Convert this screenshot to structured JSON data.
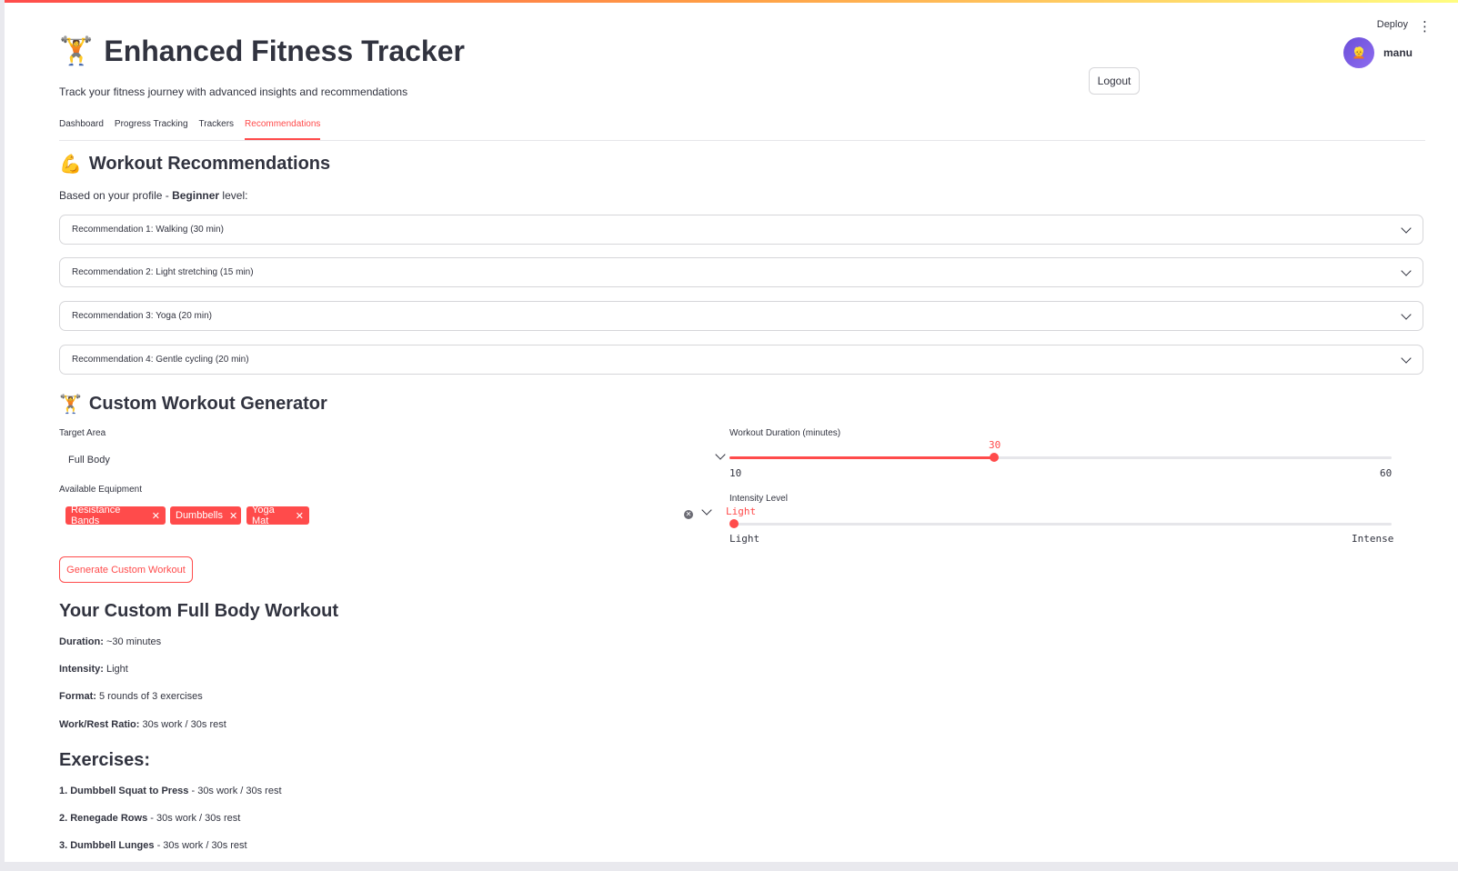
{
  "header": {
    "deploy_label": "Deploy",
    "menu_icon": "kebab-menu-icon",
    "title_icon": "weightlifter-emoji",
    "title": "Enhanced Fitness Tracker",
    "subtitle": "Track your fitness journey with advanced insights and recommendations",
    "username": "manu",
    "logout_label": "Logout"
  },
  "tabs": [
    {
      "label": "Dashboard",
      "active": false
    },
    {
      "label": "Progress Tracking",
      "active": false
    },
    {
      "label": "Trackers",
      "active": false
    },
    {
      "label": "Recommendations",
      "active": true
    }
  ],
  "recommendations": {
    "icon": "flexed-biceps-emoji",
    "heading": "Workout Recommendations",
    "profile_prefix": "Based on your profile - ",
    "profile_level": "Beginner",
    "profile_suffix": " level:",
    "items": [
      "Recommendation 1: Walking (30 min)",
      "Recommendation 2: Light stretching (15 min)",
      "Recommendation 3: Yoga (20 min)",
      "Recommendation 4: Gentle cycling (20 min)"
    ]
  },
  "generator": {
    "icon": "weightlifter-emoji",
    "heading": "Custom Workout Generator",
    "target_area": {
      "label": "Target Area",
      "value": "Full Body"
    },
    "equipment": {
      "label": "Available Equipment",
      "selected": [
        "Resistance Bands",
        "Dumbbells",
        "Yoga Mat"
      ]
    },
    "duration": {
      "label": "Workout Duration (minutes)",
      "value": "30",
      "min": "10",
      "max": "60",
      "fraction": 0.4
    },
    "intensity": {
      "label": "Intensity Level",
      "value": "Light",
      "min": "Light",
      "max": "Intense",
      "fraction": 0
    },
    "generate_label": "Generate Custom Workout"
  },
  "workout": {
    "heading": "Your Custom Full Body Workout",
    "details": [
      {
        "label": "Duration:",
        "value": " ~30 minutes"
      },
      {
        "label": "Intensity:",
        "value": " Light"
      },
      {
        "label": "Format:",
        "value": " 5 rounds of 3 exercises"
      },
      {
        "label": "Work/Rest Ratio:",
        "value": " 30s work / 30s rest"
      }
    ],
    "exercises_heading": "Exercises:",
    "exercises": [
      {
        "label": "1. Dumbbell Squat to Press",
        "value": " - 30s work / 30s rest"
      },
      {
        "label": "2. Renegade Rows",
        "value": " - 30s work / 30s rest"
      },
      {
        "label": "3. Dumbbell Lunges",
        "value": " - 30s work / 30s rest"
      }
    ]
  },
  "colors": {
    "accent": "#ff4b4b",
    "text": "#31333f",
    "border": "#d6d6d9",
    "avatar": "#6b4fd8"
  }
}
